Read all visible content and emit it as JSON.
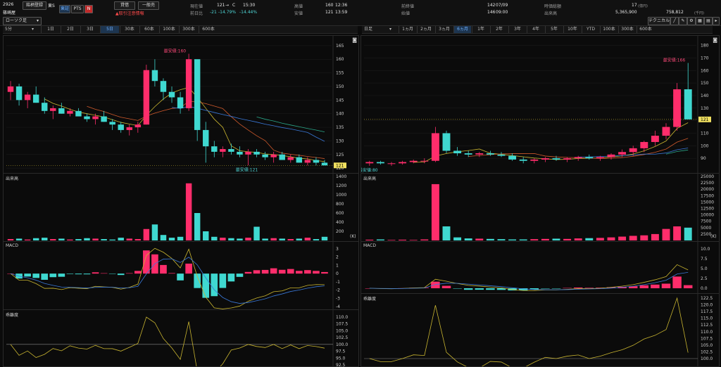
{
  "header": {
    "code": "2926",
    "register_label": "銘柄登録",
    "exchange_label": "東S",
    "market_tabs": [
      "東証",
      "PTS"
    ],
    "n_badge": "N",
    "borrow_label": "貸借",
    "general_label": "一般売",
    "warning_label": "取引注意情報",
    "company": "篠崎屋",
    "chart_type": "ローソク足",
    "current_price_label": "現在値",
    "current_price": "121",
    "current_price_flag": "C",
    "current_time": "15:30",
    "prev_ratio_label": "前日比",
    "prev_change": "-21",
    "prev_change_pct": "-14.79%",
    "prev_change_pct2": "-14.44%",
    "high_label": "高値",
    "high_value": "160",
    "high_time": "12:36",
    "low_label": "安値",
    "low_value": "121",
    "low_time": "13:59",
    "prev_close_label": "前終値",
    "prev_close": "142",
    "prev_close_date": "07/09",
    "open_label": "始値",
    "open_value": "146",
    "open_time": "09:00",
    "mcap_label": "時価総額",
    "mcap_value": "17",
    "mcap_unit": "(億円)",
    "volume_label": "出来高",
    "volume_value": "5,365,900",
    "turnover_value": "758,812",
    "turnover_unit": "(千円)",
    "technical_label": "テクニカル"
  },
  "left_tabs": {
    "interval": "5分",
    "items": [
      "1日",
      "2日",
      "3日",
      "5日",
      "30本",
      "60本",
      "100本",
      "300本",
      "600本"
    ],
    "active": 3
  },
  "right_tabs": {
    "interval": "日足",
    "items": [
      "1ヵ月",
      "2ヵ月",
      "3ヵ月",
      "6ヵ月",
      "1年",
      "2年",
      "3年",
      "4年",
      "5年",
      "10年",
      "YTD",
      "100本",
      "300本",
      "600本"
    ],
    "active": 3
  },
  "panels": {
    "volume_title": "出来高",
    "macd_title": "MACD",
    "bias_title": "乖離度",
    "k_unit": "(K)"
  },
  "left_price": {
    "ticks": [
      "165",
      "160",
      "155",
      "150",
      "145",
      "140",
      "135",
      "130",
      "125",
      "120"
    ],
    "ymin": 119,
    "ymax": 166,
    "current_box": "121",
    "high_annot": "最安値:160",
    "low_annot": "最安値:121"
  },
  "right_price": {
    "ticks": [
      "180",
      "170",
      "160",
      "150",
      "140",
      "130",
      "120",
      "110",
      "100",
      "90"
    ],
    "ymin": 80,
    "ymax": 182,
    "current_box": "121",
    "high_annot": "最安値:166",
    "low_annot": "最安値:80"
  },
  "left_volume_ticks": [
    "1400",
    "1200",
    "1000",
    "800",
    "600",
    "400",
    "200"
  ],
  "right_volume_ticks": [
    "25000",
    "22500",
    "20000",
    "17500",
    "15000",
    "12500",
    "10000",
    "7500",
    "5000",
    "2500"
  ],
  "left_macd_ticks": [
    "3",
    "2",
    "1",
    "0",
    "-1",
    "-2",
    "-3",
    "-4"
  ],
  "right_macd_ticks": [
    "10.0",
    "7.5",
    "5.0",
    "2.5",
    "0.0"
  ],
  "left_bias_ticks": [
    "110.0",
    "107.5",
    "105.0",
    "102.5",
    "100.0",
    "97.5",
    "95.0",
    "92.5"
  ],
  "right_bias_ticks": [
    "122.5",
    "120.0",
    "117.5",
    "115.0",
    "112.5",
    "110.0",
    "107.5",
    "105.0",
    "102.5",
    "100.0"
  ],
  "colors": {
    "up": "#ff2d6b",
    "down": "#3fd8d0",
    "ma1": "#c9b530",
    "ma2": "#d05a2c",
    "ma3": "#3a78d8",
    "ma4": "#2aa88a",
    "ma5": "#b05aa0"
  },
  "chart_data": [
    {
      "type": "candlestick",
      "name": "5分足",
      "ohlc": [
        [
          148,
          152,
          145,
          150
        ],
        [
          150,
          151,
          143,
          145
        ],
        [
          145,
          148,
          142,
          147
        ],
        [
          147,
          150,
          144,
          144
        ],
        [
          144,
          146,
          140,
          141
        ],
        [
          141,
          143,
          138,
          142
        ],
        [
          142,
          144,
          140,
          140
        ],
        [
          140,
          142,
          139,
          141
        ],
        [
          141,
          142,
          139,
          139
        ],
        [
          139,
          140,
          137,
          138
        ],
        [
          138,
          140,
          136,
          139
        ],
        [
          139,
          141,
          137,
          137
        ],
        [
          137,
          138,
          134,
          136
        ],
        [
          136,
          137,
          133,
          134
        ],
        [
          134,
          136,
          132,
          135
        ],
        [
          135,
          137,
          133,
          136
        ],
        [
          136,
          158,
          136,
          156
        ],
        [
          156,
          160,
          150,
          152
        ],
        [
          152,
          153,
          145,
          148
        ],
        [
          148,
          150,
          144,
          146
        ],
        [
          146,
          148,
          140,
          142
        ],
        [
          142,
          162,
          141,
          160
        ],
        [
          160,
          158,
          130,
          134
        ],
        [
          134,
          137,
          122,
          128
        ],
        [
          128,
          130,
          124,
          126
        ],
        [
          126,
          128,
          124,
          127
        ],
        [
          127,
          129,
          125,
          126
        ],
        [
          126,
          128,
          124,
          125
        ],
        [
          125,
          127,
          121,
          126
        ],
        [
          126,
          127,
          124,
          125
        ],
        [
          125,
          126,
          123,
          124
        ],
        [
          124,
          126,
          122,
          125
        ],
        [
          125,
          126,
          123,
          123
        ],
        [
          123,
          125,
          122,
          124
        ],
        [
          124,
          125,
          122,
          122
        ],
        [
          122,
          124,
          121,
          123
        ],
        [
          123,
          124,
          121,
          122
        ],
        [
          122,
          123,
          121,
          121
        ]
      ],
      "volume_k": [
        30,
        40,
        20,
        50,
        60,
        30,
        40,
        20,
        30,
        50,
        40,
        30,
        20,
        60,
        40,
        30,
        250,
        350,
        120,
        60,
        80,
        1250,
        600,
        200,
        80,
        60,
        50,
        40,
        60,
        300,
        40,
        50,
        40,
        30,
        40,
        60,
        30,
        80
      ]
    },
    {
      "type": "candlestick",
      "name": "日足",
      "ohlc": [
        [
          86,
          88,
          84,
          87
        ],
        [
          87,
          88,
          85,
          86
        ],
        [
          86,
          87,
          84,
          86
        ],
        [
          86,
          88,
          85,
          87
        ],
        [
          87,
          89,
          86,
          88
        ],
        [
          88,
          90,
          86,
          88
        ],
        [
          88,
          115,
          87,
          110
        ],
        [
          110,
          112,
          94,
          96
        ],
        [
          96,
          99,
          92,
          94
        ],
        [
          94,
          96,
          91,
          93
        ],
        [
          93,
          95,
          91,
          94
        ],
        [
          94,
          96,
          92,
          93
        ],
        [
          93,
          95,
          91,
          92
        ],
        [
          92,
          94,
          88,
          89
        ],
        [
          89,
          91,
          86,
          88
        ],
        [
          88,
          90,
          86,
          89
        ],
        [
          89,
          91,
          87,
          90
        ],
        [
          90,
          92,
          88,
          89
        ],
        [
          89,
          91,
          87,
          90
        ],
        [
          90,
          92,
          88,
          91
        ],
        [
          91,
          93,
          89,
          90
        ],
        [
          90,
          92,
          88,
          91
        ],
        [
          91,
          94,
          89,
          93
        ],
        [
          93,
          97,
          91,
          95
        ],
        [
          95,
          100,
          92,
          98
        ],
        [
          98,
          104,
          95,
          103
        ],
        [
          103,
          112,
          100,
          108
        ],
        [
          108,
          118,
          105,
          115
        ],
        [
          115,
          150,
          112,
          145
        ],
        [
          145,
          166,
          138,
          121
        ]
      ],
      "volume_k": [
        300,
        400,
        200,
        300,
        200,
        400,
        22000,
        5500,
        1200,
        800,
        700,
        600,
        500,
        400,
        400,
        500,
        600,
        700,
        600,
        800,
        900,
        1000,
        1200,
        1500,
        1800,
        2000,
        2500,
        4500,
        5500,
        5000
      ]
    }
  ]
}
